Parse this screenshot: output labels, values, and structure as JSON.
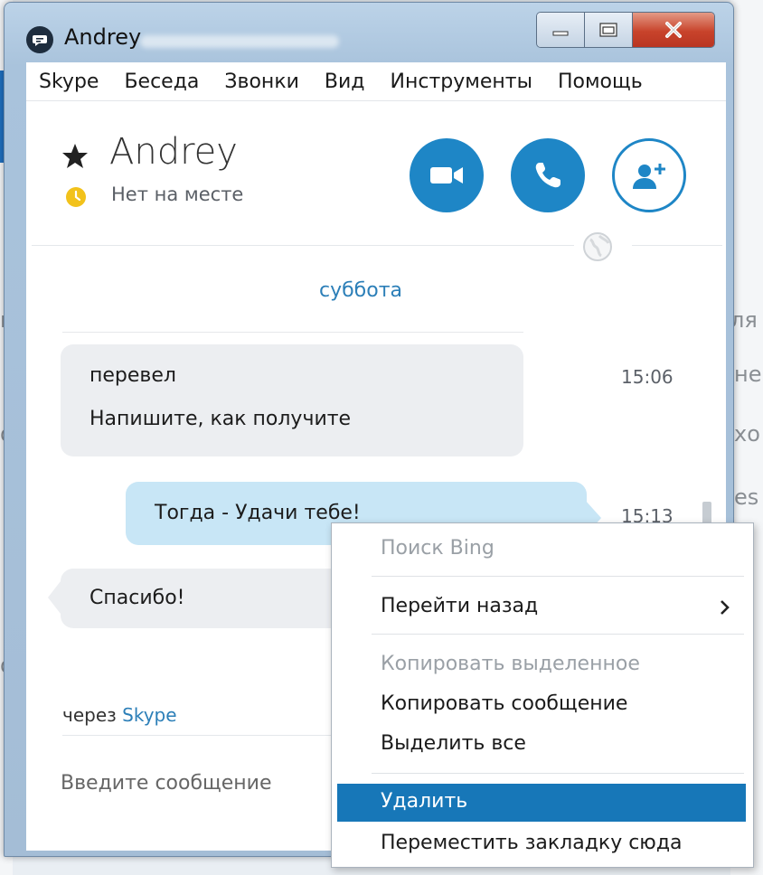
{
  "window": {
    "title": "Andrey"
  },
  "menu": [
    "Skype",
    "Беседа",
    "Звонки",
    "Вид",
    "Инструменты",
    "Помощь"
  ],
  "contact": {
    "name": "Andrey",
    "status": "Нет на месте"
  },
  "actions": {
    "video": "video-call-icon",
    "audio": "phone-call-icon",
    "add": "add-contact-icon"
  },
  "conversation": {
    "date": "суббота",
    "messages": [
      {
        "direction": "in",
        "lines": [
          "перевел",
          "Напишите, как получите"
        ],
        "time": "15:06"
      },
      {
        "direction": "out",
        "lines": [
          "Тогда - Удачи тебе!"
        ],
        "time": "15:13"
      },
      {
        "direction": "in",
        "lines": [
          "Спасибо!"
        ],
        "time": ""
      }
    ],
    "via_prefix": "через",
    "via_link": "Skype"
  },
  "compose": {
    "placeholder": "Введите сообщение"
  },
  "context_menu": {
    "items": [
      {
        "label": "Поиск Bing",
        "disabled": true
      },
      {
        "label": "Перейти назад",
        "submenu": true
      },
      {
        "label": "Копировать выделенное",
        "disabled": true
      },
      {
        "label": "Копировать сообщение"
      },
      {
        "label": "Выделить все"
      },
      {
        "label": "Удалить",
        "highlighted": true
      },
      {
        "label": "Переместить закладку сюда"
      }
    ]
  },
  "background": {
    "fragments": [
      "й",
      "ля",
      "не",
      "хо",
      "es",
      "о",
      "о",
      "о"
    ]
  },
  "colors": {
    "accent": "#1e86c6",
    "highlight": "#1777b8",
    "outgoing_bubble": "#c8e6f6",
    "incoming_bubble": "#eceef1",
    "away": "#f2c21b"
  }
}
